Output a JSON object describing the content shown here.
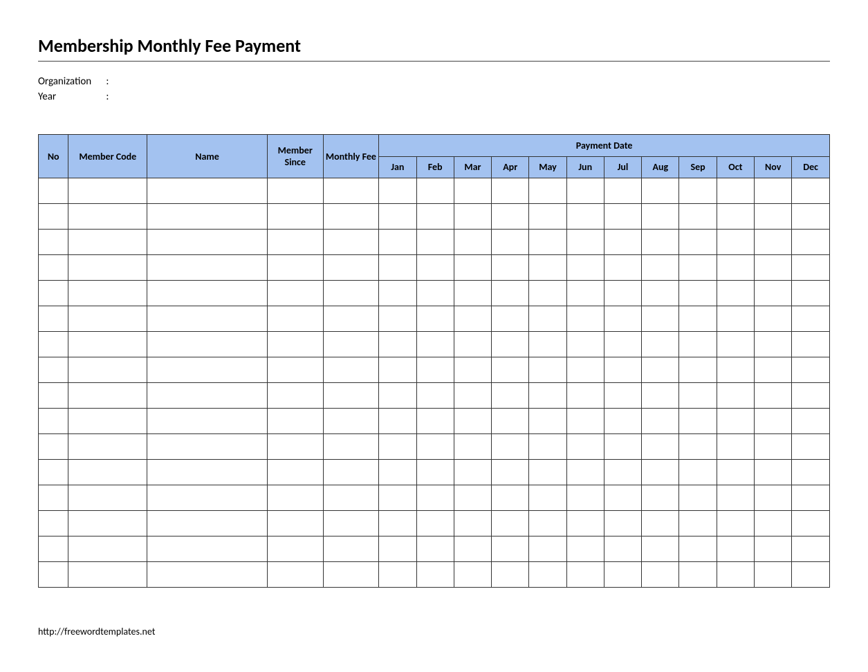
{
  "title": "Membership Monthly Fee Payment",
  "meta": {
    "organization_label": "Organization",
    "year_label": "Year",
    "colon": ":"
  },
  "headers": {
    "no": "No",
    "member_code": "Member Code",
    "name": "Name",
    "member_since": "Member Since",
    "monthly_fee": "Monthly Fee",
    "payment_date": "Payment Date",
    "months": [
      "Jan",
      "Feb",
      "Mar",
      "Apr",
      "May",
      "Jun",
      "Jul",
      "Aug",
      "Sep",
      "Oct",
      "Nov",
      "Dec"
    ]
  },
  "rows": [
    {
      "no": "",
      "code": "",
      "name": "",
      "since": "",
      "fee": "",
      "m": [
        "",
        "",
        "",
        "",
        "",
        "",
        "",
        "",
        "",
        "",
        "",
        ""
      ]
    },
    {
      "no": "",
      "code": "",
      "name": "",
      "since": "",
      "fee": "",
      "m": [
        "",
        "",
        "",
        "",
        "",
        "",
        "",
        "",
        "",
        "",
        "",
        ""
      ]
    },
    {
      "no": "",
      "code": "",
      "name": "",
      "since": "",
      "fee": "",
      "m": [
        "",
        "",
        "",
        "",
        "",
        "",
        "",
        "",
        "",
        "",
        "",
        ""
      ]
    },
    {
      "no": "",
      "code": "",
      "name": "",
      "since": "",
      "fee": "",
      "m": [
        "",
        "",
        "",
        "",
        "",
        "",
        "",
        "",
        "",
        "",
        "",
        ""
      ]
    },
    {
      "no": "",
      "code": "",
      "name": "",
      "since": "",
      "fee": "",
      "m": [
        "",
        "",
        "",
        "",
        "",
        "",
        "",
        "",
        "",
        "",
        "",
        ""
      ]
    },
    {
      "no": "",
      "code": "",
      "name": "",
      "since": "",
      "fee": "",
      "m": [
        "",
        "",
        "",
        "",
        "",
        "",
        "",
        "",
        "",
        "",
        "",
        ""
      ]
    },
    {
      "no": "",
      "code": "",
      "name": "",
      "since": "",
      "fee": "",
      "m": [
        "",
        "",
        "",
        "",
        "",
        "",
        "",
        "",
        "",
        "",
        "",
        ""
      ]
    },
    {
      "no": "",
      "code": "",
      "name": "",
      "since": "",
      "fee": "",
      "m": [
        "",
        "",
        "",
        "",
        "",
        "",
        "",
        "",
        "",
        "",
        "",
        ""
      ]
    },
    {
      "no": "",
      "code": "",
      "name": "",
      "since": "",
      "fee": "",
      "m": [
        "",
        "",
        "",
        "",
        "",
        "",
        "",
        "",
        "",
        "",
        "",
        ""
      ]
    },
    {
      "no": "",
      "code": "",
      "name": "",
      "since": "",
      "fee": "",
      "m": [
        "",
        "",
        "",
        "",
        "",
        "",
        "",
        "",
        "",
        "",
        "",
        ""
      ]
    },
    {
      "no": "",
      "code": "",
      "name": "",
      "since": "",
      "fee": "",
      "m": [
        "",
        "",
        "",
        "",
        "",
        "",
        "",
        "",
        "",
        "",
        "",
        ""
      ]
    },
    {
      "no": "",
      "code": "",
      "name": "",
      "since": "",
      "fee": "",
      "m": [
        "",
        "",
        "",
        "",
        "",
        "",
        "",
        "",
        "",
        "",
        "",
        ""
      ]
    },
    {
      "no": "",
      "code": "",
      "name": "",
      "since": "",
      "fee": "",
      "m": [
        "",
        "",
        "",
        "",
        "",
        "",
        "",
        "",
        "",
        "",
        "",
        ""
      ]
    },
    {
      "no": "",
      "code": "",
      "name": "",
      "since": "",
      "fee": "",
      "m": [
        "",
        "",
        "",
        "",
        "",
        "",
        "",
        "",
        "",
        "",
        "",
        ""
      ]
    },
    {
      "no": "",
      "code": "",
      "name": "",
      "since": "",
      "fee": "",
      "m": [
        "",
        "",
        "",
        "",
        "",
        "",
        "",
        "",
        "",
        "",
        "",
        ""
      ]
    },
    {
      "no": "",
      "code": "",
      "name": "",
      "since": "",
      "fee": "",
      "m": [
        "",
        "",
        "",
        "",
        "",
        "",
        "",
        "",
        "",
        "",
        "",
        ""
      ]
    }
  ],
  "footer": "http://freewordtemplates.net"
}
